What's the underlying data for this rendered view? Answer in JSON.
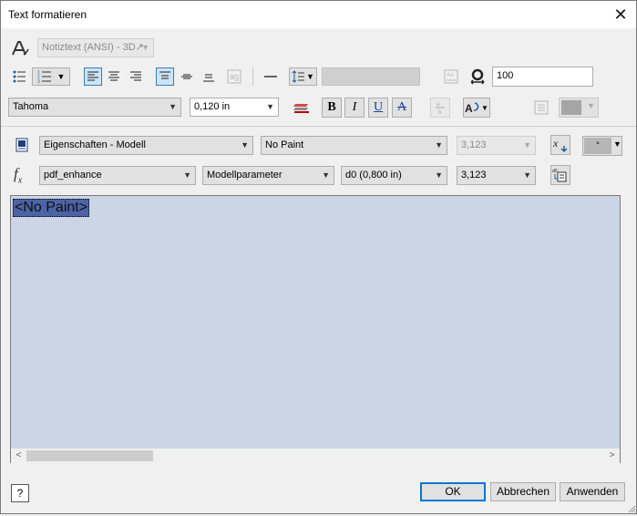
{
  "window": {
    "title": "Text formatieren",
    "close_glyph": "✕"
  },
  "row1": {
    "text_style": "Notiztext (ANSI) - 3D↗"
  },
  "row2": {
    "width_value": "100"
  },
  "row3": {
    "font": "Tahoma",
    "size": "0,120 in",
    "bold": "B",
    "italic": "I",
    "underline": "U",
    "strike": "A"
  },
  "row4": {
    "source": "Eigenschaften - Modell",
    "property": "No Paint",
    "precision_disabled": "3,123"
  },
  "row5": {
    "component": "pdf_enhance",
    "param_type": "Modellparameter",
    "parameter": "d0 (0,800 in)",
    "precision": "3,123",
    "fx": "f",
    "fx_sub": "x"
  },
  "editor": {
    "content": "<No Paint>"
  },
  "buttons": {
    "ok": "OK",
    "cancel": "Abbrechen",
    "apply": "Anwenden"
  },
  "colors": {
    "accent": "#0078d7",
    "editor_bg": "#cbd5e5",
    "selection": "#4b64a6"
  }
}
